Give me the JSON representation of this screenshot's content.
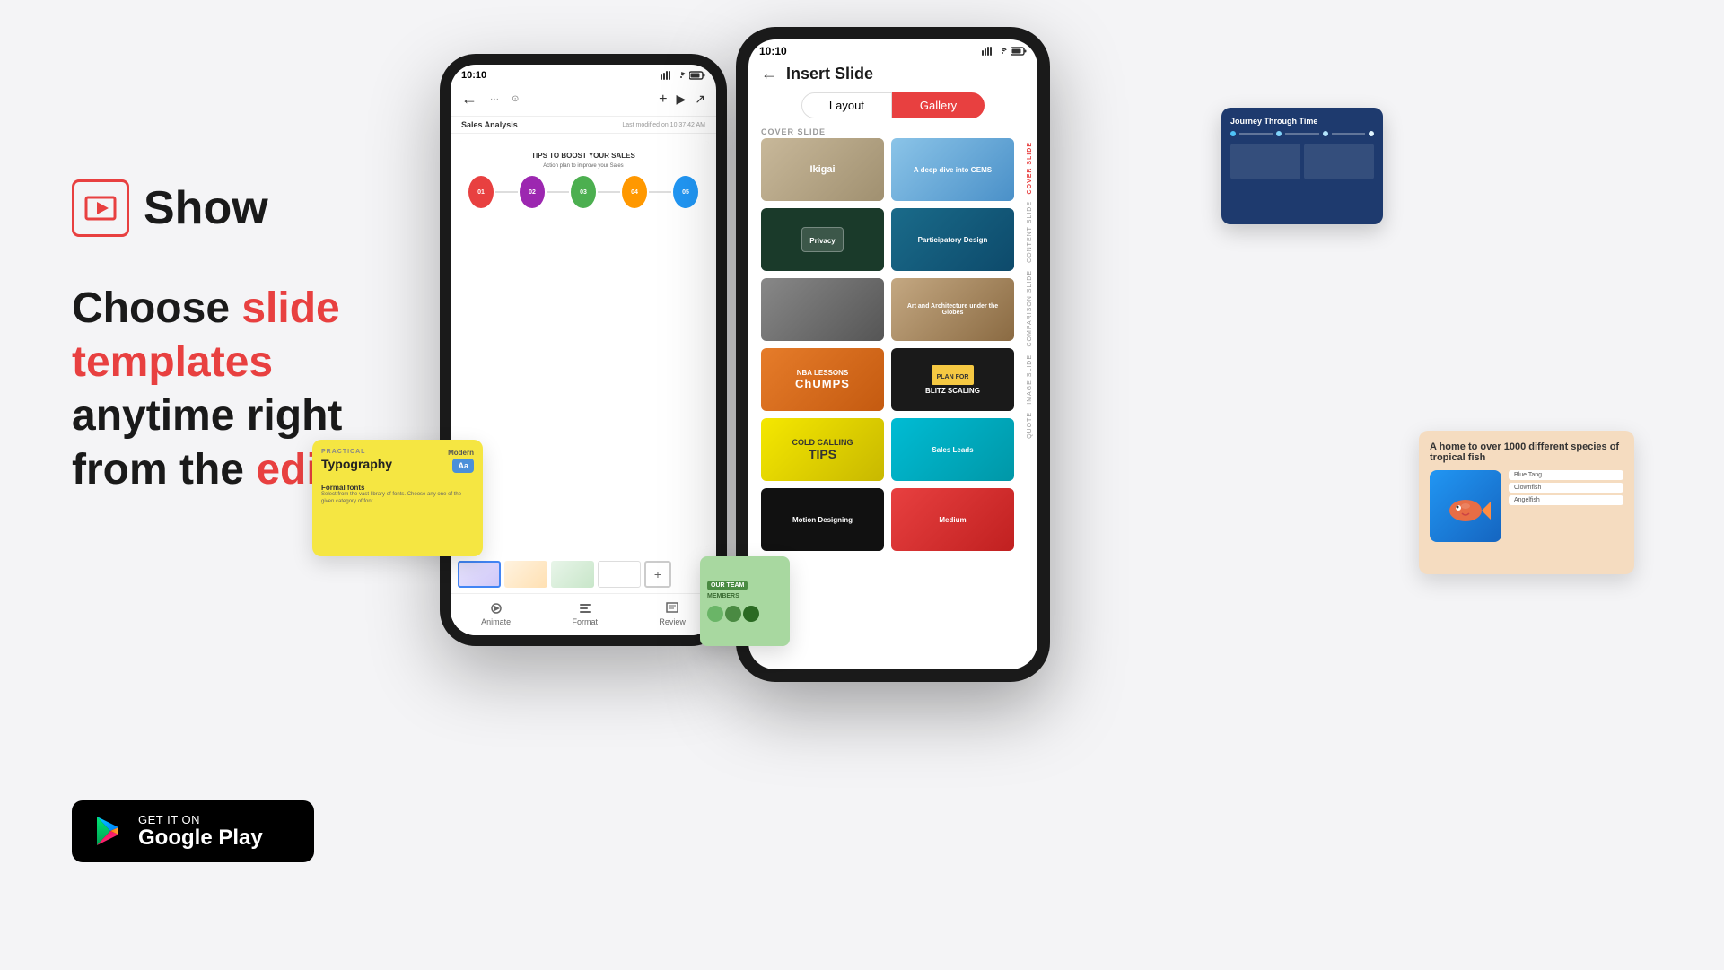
{
  "logo": {
    "text": "Show"
  },
  "headline": {
    "line1_normal": "Choose ",
    "line1_highlight": "slide templates",
    "line2": "anytime right",
    "line3_normal": "from the ",
    "line3_highlight": "editor"
  },
  "google_play": {
    "get_it_on": "GET IT ON",
    "label": "Google Play"
  },
  "phone1": {
    "status_time": "10:10",
    "nav_title": "Sales Analysis",
    "nav_modified": "Last modified on 10:37:42 AM",
    "slide_title": "TIPS TO BOOST YOUR SALES",
    "slide_subtitle": "Action plan to improve your Sales",
    "bottom_nav": [
      "Animate",
      "Format",
      "Review"
    ]
  },
  "phone2": {
    "status_time": "10:10",
    "title": "Insert Slide",
    "tab_layout": "Layout",
    "tab_gallery": "Gallery",
    "section_cover": "COVER SLIDE",
    "section_content": "CONTENT SLIDE",
    "section_comparison": "COMPARISON SLIDE",
    "section_image": "IMAGE SLIDE",
    "section_quote": "QUOTE",
    "card_privacy": "Privacy",
    "card_participatory": "Participatory Design",
    "card_art": "Art and Architecture under the Globes",
    "card_nba": "NBA LESSONS CHAMPS",
    "card_blitz": "BLITZ SCALING",
    "card_cold": "COLD CALLING",
    "card_tips": "TIPS",
    "card_sales": "Sales Leads",
    "card_motion": "Motion Designing",
    "card_medium": "Medium"
  },
  "float_typography": {
    "label": "PRACTICAL",
    "title": "Typography",
    "modern": "Modern",
    "font_sample": "Aa",
    "formal_label": "Formal fonts",
    "formal_desc": "Select from the vast library of fonts. Choose any one of the given category of font."
  },
  "float_dark_blue": {
    "title": "Journey Through Time"
  },
  "float_peach": {
    "title": "A home to over 1000 different species of tropical fish",
    "items": [
      "Blue Tang",
      "Clownfish",
      "Angelfish"
    ]
  }
}
